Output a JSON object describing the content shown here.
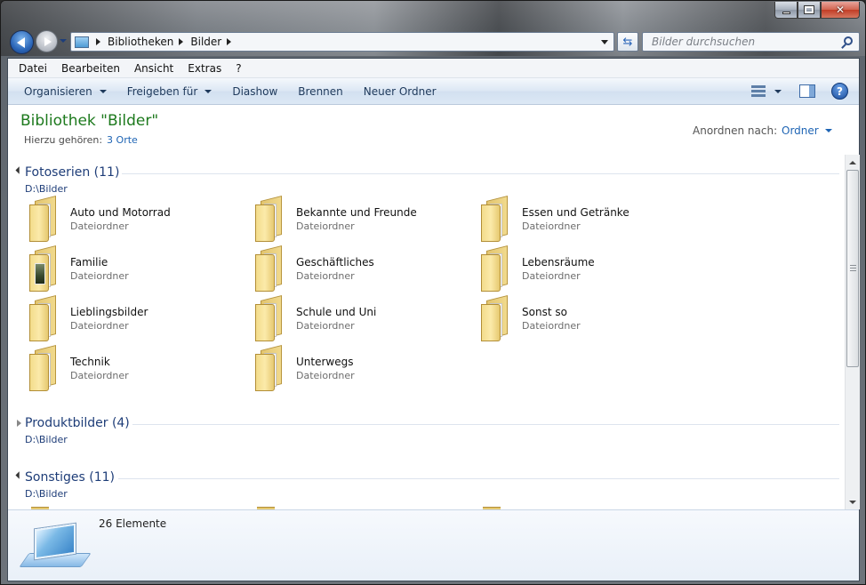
{
  "window": {
    "accent": "#1e7a1e",
    "link_color": "#1e64b4"
  },
  "address": {
    "crumbs": [
      "Bibliotheken",
      "Bilder"
    ]
  },
  "search": {
    "placeholder": "Bilder durchsuchen"
  },
  "menu": {
    "items": [
      "Datei",
      "Bearbeiten",
      "Ansicht",
      "Extras",
      "?"
    ]
  },
  "commands": {
    "organize": "Organisieren",
    "share": "Freigeben für",
    "slideshow": "Diashow",
    "burn": "Brennen",
    "new_folder": "Neuer Ordner"
  },
  "library": {
    "title": "Bibliothek \"Bilder\"",
    "includes_label": "Hierzu gehören:",
    "includes_link": "3 Orte",
    "arrange_label": "Anordnen nach:",
    "arrange_value": "Ordner"
  },
  "groups": [
    {
      "title": "Fotoserien (11)",
      "path": "D:\\Bilder",
      "expanded": true,
      "items": [
        {
          "name": "Auto und Motorrad",
          "type": "Dateiordner",
          "icon": "folder-icon"
        },
        {
          "name": "Bekannte und Freunde",
          "type": "Dateiordner",
          "icon": "folder-icon"
        },
        {
          "name": "Essen und Getränke",
          "type": "Dateiordner",
          "icon": "folder-icon"
        },
        {
          "name": "Familie",
          "type": "Dateiordner",
          "icon": "photo-folder-icon"
        },
        {
          "name": "Geschäftliches",
          "type": "Dateiordner",
          "icon": "folder-icon"
        },
        {
          "name": "Lebensräume",
          "type": "Dateiordner",
          "icon": "folder-icon"
        },
        {
          "name": "Lieblingsbilder",
          "type": "Dateiordner",
          "icon": "folder-icon"
        },
        {
          "name": "Schule und Uni",
          "type": "Dateiordner",
          "icon": "folder-icon"
        },
        {
          "name": "Sonst so",
          "type": "Dateiordner",
          "icon": "folder-icon"
        },
        {
          "name": "Technik",
          "type": "Dateiordner",
          "icon": "folder-icon"
        },
        {
          "name": "Unterwegs",
          "type": "Dateiordner",
          "icon": "folder-icon"
        }
      ]
    },
    {
      "title": "Produktbilder (4)",
      "path": "D:\\Bilder",
      "expanded": false
    },
    {
      "title": "Sonstiges (11)",
      "path": "D:\\Bilder",
      "expanded": true
    }
  ],
  "details": {
    "count": "26 Elemente"
  }
}
